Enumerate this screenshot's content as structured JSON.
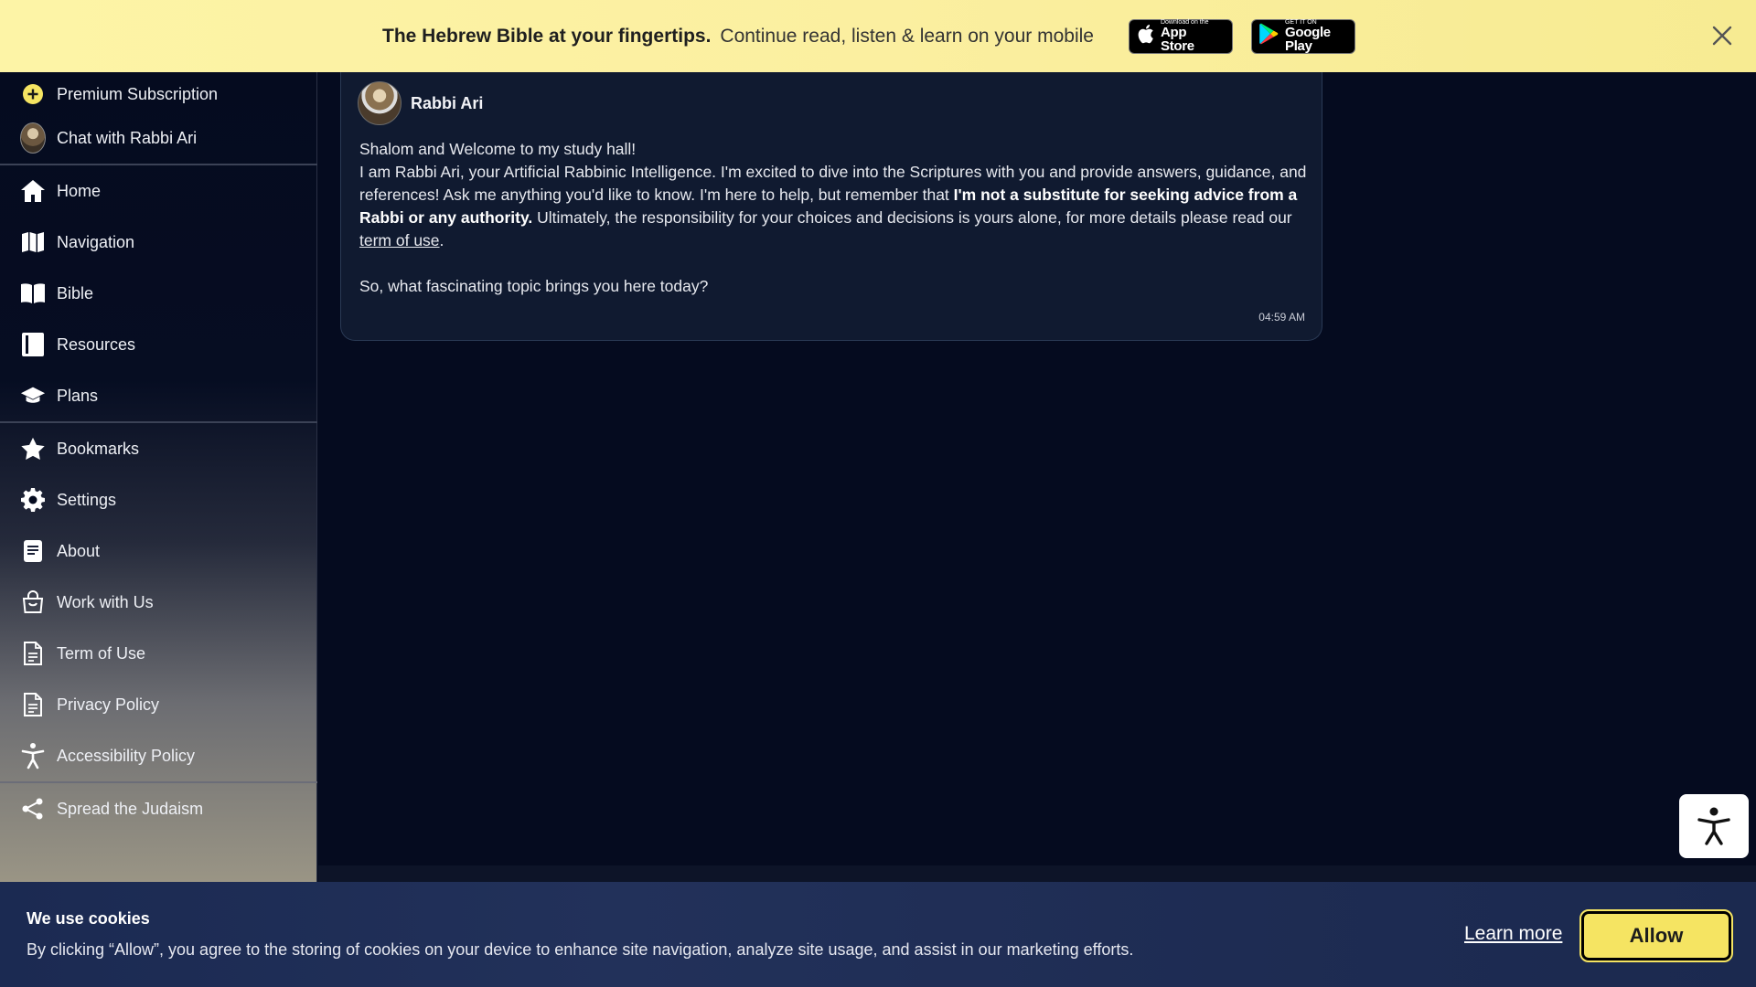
{
  "banner": {
    "bold_text": "The Hebrew Bible at your fingertips.",
    "text": "Continue read, listen & learn on your mobile",
    "app_store_small": "Download on the",
    "app_store_big": "App Store",
    "google_small": "GET IT ON",
    "google_big": "Google Play"
  },
  "sidebar": {
    "top_items": [
      {
        "label": "Premium Subscription",
        "icon": "plus-circle-icon"
      },
      {
        "label": "Chat with Rabbi Ari",
        "icon": "rabbi-avatar"
      }
    ],
    "main_items": [
      {
        "label": "Home",
        "icon": "home-icon"
      },
      {
        "label": "Navigation",
        "icon": "map-icon"
      },
      {
        "label": "Bible",
        "icon": "open-book-icon"
      },
      {
        "label": "Resources",
        "icon": "book-icon"
      },
      {
        "label": "Plans",
        "icon": "graduation-cap-icon"
      }
    ],
    "secondary_items": [
      {
        "label": "Bookmarks",
        "icon": "star-icon"
      },
      {
        "label": "Settings",
        "icon": "gear-icon"
      },
      {
        "label": "About",
        "icon": "document-icon"
      },
      {
        "label": "Work with Us",
        "icon": "bag-icon"
      },
      {
        "label": "Term of Use",
        "icon": "file-icon"
      },
      {
        "label": "Privacy Policy",
        "icon": "file-icon"
      },
      {
        "label": "Accessibility Policy",
        "icon": "accessibility-icon"
      }
    ],
    "bottom_items": [
      {
        "label": "Spread the Judaism",
        "icon": "share-icon"
      }
    ]
  },
  "chat": {
    "sender": "Rabbi Ari",
    "greeting": "Shalom and Welcome to my study hall!",
    "intro_1": "I am Rabbi Ari, your Artificial Rabbinic Intelligence. I'm excited to dive into the Scriptures with you and provide answers, guidance, and references! Ask me anything you'd like to know. I'm here to help, but remember that ",
    "intro_bold": "I'm not a substitute for seeking advice from a Rabbi or any authority.",
    "intro_2": " Ultimately, the responsibility for your choices and decisions is yours alone, for more details please read our ",
    "terms_link": "term of use",
    "intro_end": ".",
    "question": "So, what fascinating topic brings you here today?",
    "time": "04:59 AM"
  },
  "cookie": {
    "title": "We use cookies",
    "message": "By clicking “Allow”, you agree to the storing of cookies on your device to enhance site navigation, analyze site usage, and assist in our marketing efforts.",
    "learn_more": "Learn more",
    "allow": "Allow"
  }
}
